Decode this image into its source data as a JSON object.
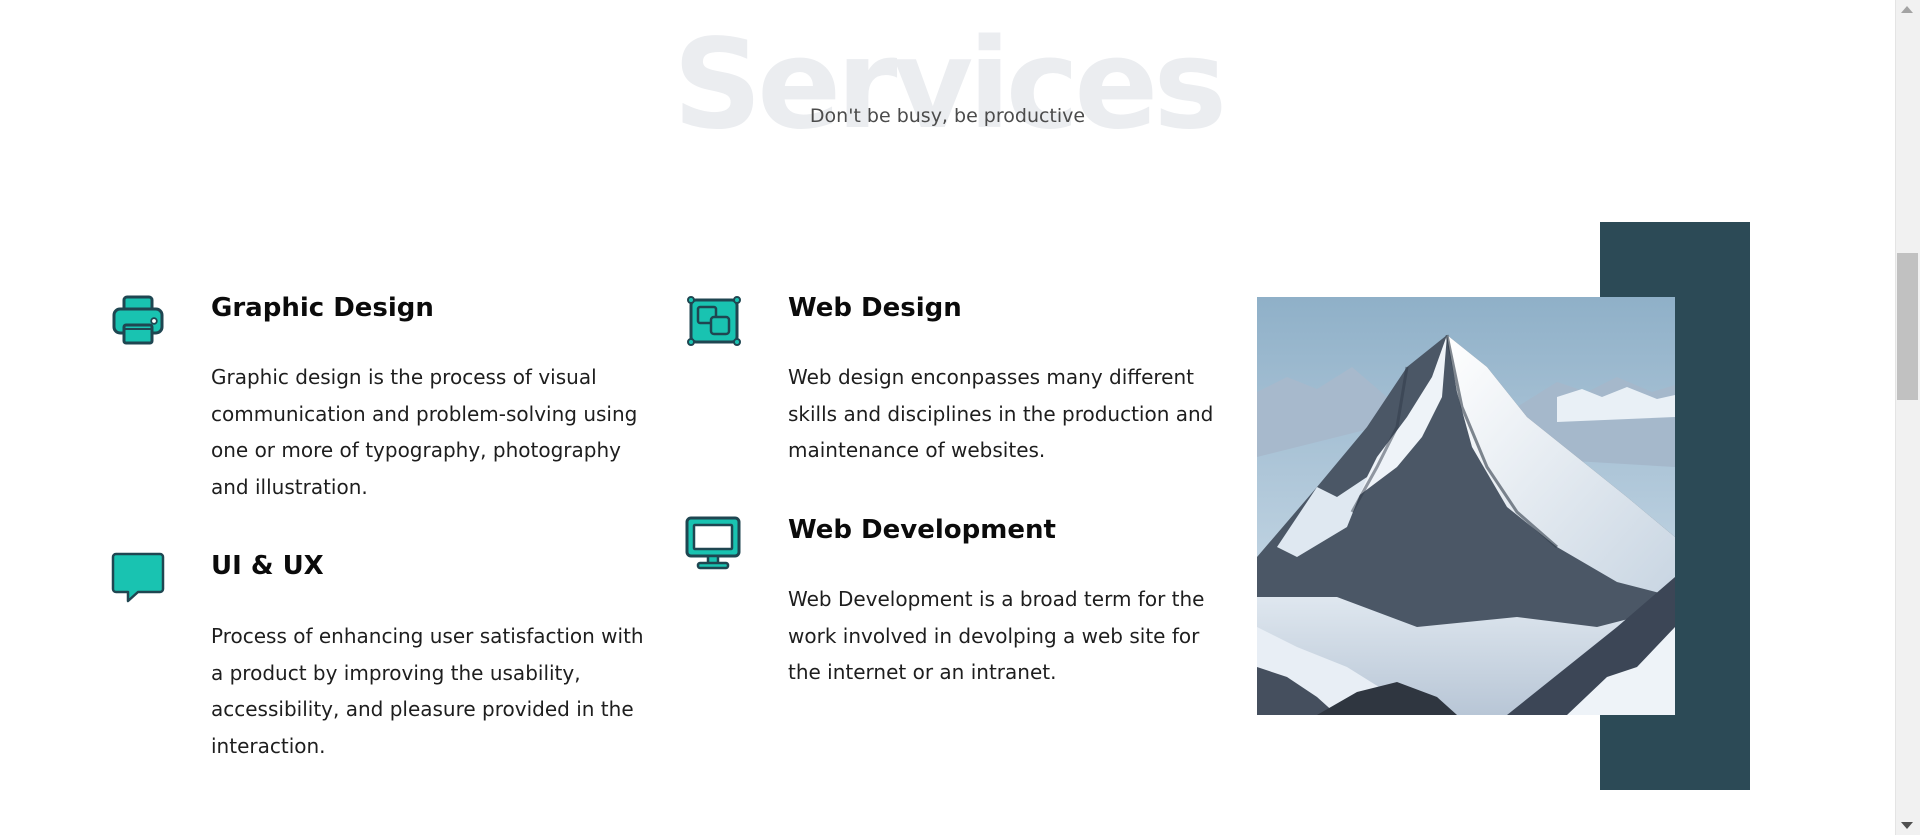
{
  "section": {
    "background_title": "Services",
    "subtitle": "Don't be busy, be productive"
  },
  "colors": {
    "accent": "#19c3b1",
    "icon_outline": "#1f4651",
    "dark_panel": "#2c4a56",
    "watermark_text": "#ebedf0"
  },
  "services": [
    {
      "icon": "printer-icon",
      "title": "Graphic Design",
      "description": "Graphic design is the process of visual communication and problem-solving using one or more of typography, photography and illustration."
    },
    {
      "icon": "chat-bubble-icon",
      "title": "UI & UX",
      "description": "Process of enhancing user satisfaction with a product by improving the usability, accessibility, and pleasure provided in the interaction."
    },
    {
      "icon": "design-frame-icon",
      "title": "Web Design",
      "description": "Web design enconpasses many different skills and disciplines in the production and maintenance of websites."
    },
    {
      "icon": "monitor-icon",
      "title": "Web Development",
      "description": "Web Development is a broad term for the work involved in devolping a web site for the internet or an intranet."
    }
  ],
  "image": {
    "subject": "snowy-mountain-photo"
  }
}
